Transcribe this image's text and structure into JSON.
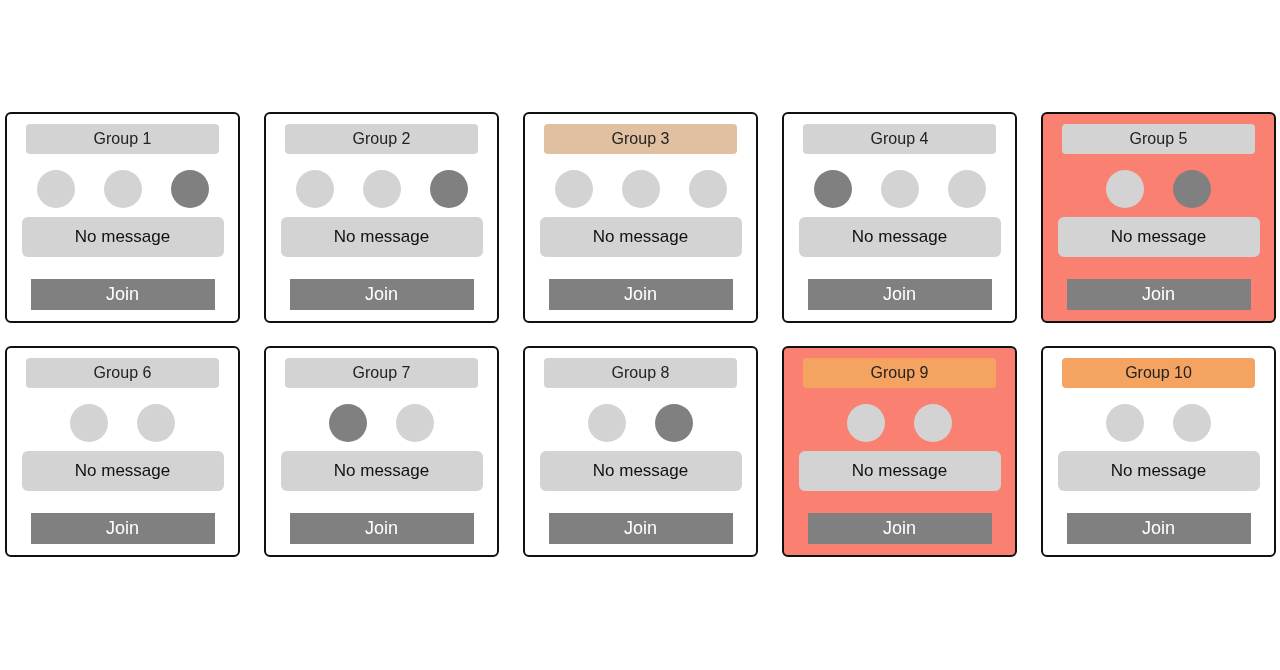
{
  "groups": [
    {
      "header": {
        "label": "Group 1",
        "color": "#d3d3d3"
      },
      "color": "#ffffff",
      "seats": [
        {
          "occupied": false
        },
        {
          "occupied": false
        },
        {
          "occupied": true
        }
      ],
      "message": "No message",
      "button": "Join"
    },
    {
      "header": {
        "label": "Group 2",
        "color": "#d3d3d3"
      },
      "color": "#ffffff",
      "seats": [
        {
          "occupied": false
        },
        {
          "occupied": false
        },
        {
          "occupied": true
        }
      ],
      "message": "No message",
      "button": "Join"
    },
    {
      "header": {
        "label": "Group 3",
        "color": "#e0c0a0"
      },
      "color": "#ffffff",
      "seats": [
        {
          "occupied": false
        },
        {
          "occupied": false
        },
        {
          "occupied": false
        }
      ],
      "message": "No message",
      "button": "Join"
    },
    {
      "header": {
        "label": "Group 4",
        "color": "#d3d3d3"
      },
      "color": "#ffffff",
      "seats": [
        {
          "occupied": true
        },
        {
          "occupied": false
        },
        {
          "occupied": false
        }
      ],
      "message": "No message",
      "button": "Join"
    },
    {
      "header": {
        "label": "Group 5",
        "color": "#d3d3d3"
      },
      "color": "#fa8072",
      "seats": [
        {
          "occupied": false
        },
        {
          "occupied": true
        }
      ],
      "message": "No message",
      "button": "Join"
    },
    {
      "header": {
        "label": "Group 6",
        "color": "#d3d3d3"
      },
      "color": "#ffffff",
      "seats": [
        {
          "occupied": false
        },
        {
          "occupied": false
        }
      ],
      "message": "No message",
      "button": "Join"
    },
    {
      "header": {
        "label": "Group 7",
        "color": "#d3d3d3"
      },
      "color": "#ffffff",
      "seats": [
        {
          "occupied": true
        },
        {
          "occupied": false
        }
      ],
      "message": "No message",
      "button": "Join"
    },
    {
      "header": {
        "label": "Group 8",
        "color": "#d3d3d3"
      },
      "color": "#ffffff",
      "seats": [
        {
          "occupied": false
        },
        {
          "occupied": true
        }
      ],
      "message": "No message",
      "button": "Join"
    },
    {
      "header": {
        "label": "Group 9",
        "color": "#f4a460"
      },
      "color": "#fa8072",
      "seats": [
        {
          "occupied": false
        },
        {
          "occupied": false
        }
      ],
      "message": "No message",
      "button": "Join"
    },
    {
      "header": {
        "label": "Group 10",
        "color": "#f4a460"
      },
      "color": "#ffffff",
      "seats": [
        {
          "occupied": false
        },
        {
          "occupied": false
        }
      ],
      "message": "No message",
      "button": "Join"
    }
  ]
}
